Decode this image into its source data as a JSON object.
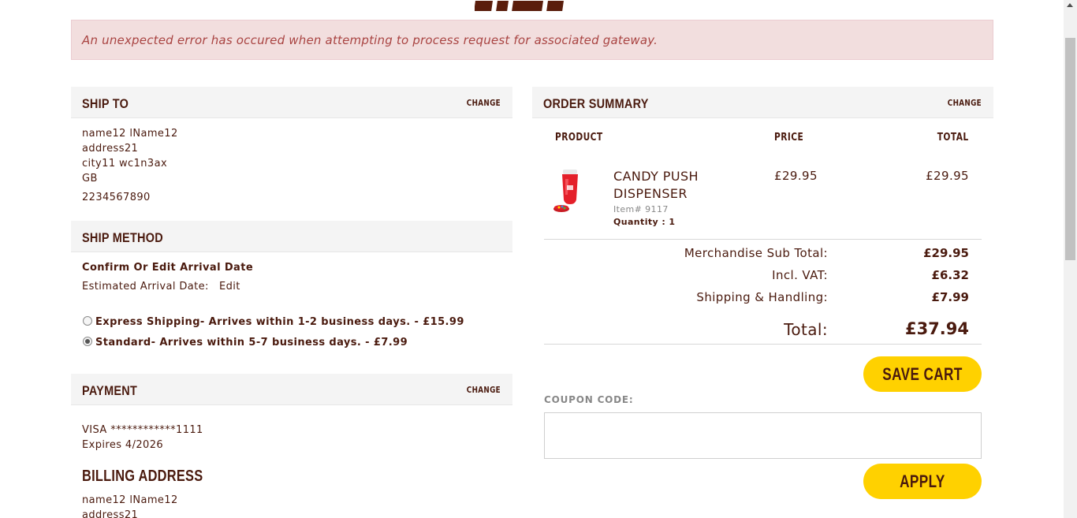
{
  "error": {
    "message": "An unexpected error has occured when attempting to process request for associated gateway."
  },
  "ship_to": {
    "title": "SHIP TO",
    "change_label": "CHANGE",
    "lines": [
      "name12 lName12",
      "address21",
      "city11 wc1n3ax",
      "GB"
    ],
    "phone": "2234567890"
  },
  "ship_method": {
    "title": "SHIP METHOD",
    "confirm_label": "Confirm Or Edit Arrival Date",
    "estimated_label": "Estimated Arrival Date:",
    "edit_label": "Edit",
    "options": [
      {
        "label": "Express Shipping- Arrives within 1-2 business days.  - £15.99",
        "selected": false
      },
      {
        "label": "Standard- Arrives within 5-7 business days.  - £7.99",
        "selected": true
      }
    ]
  },
  "payment": {
    "title": "PAYMENT",
    "change_label": "CHANGE",
    "card": "VISA ************1111",
    "expires": "Expires 4/2026"
  },
  "billing": {
    "title": "BILLING ADDRESS",
    "lines": [
      "name12 lName12",
      "address21"
    ]
  },
  "order_summary": {
    "title": "ORDER SUMMARY",
    "change_label": "CHANGE",
    "columns": {
      "product": "PRODUCT",
      "price": "PRICE",
      "total": "TOTAL"
    },
    "items": [
      {
        "name_line1": "CANDY PUSH",
        "name_line2": "DISPENSER",
        "item_no": "Item# 9117",
        "quantity": "Quantity : 1",
        "price": "£29.95",
        "total": "£29.95"
      }
    ],
    "totals": {
      "subtotal_label": "Merchandise Sub Total:",
      "subtotal": "£29.95",
      "vat_label": "Incl. VAT:",
      "vat": "£6.32",
      "shipping_label": "Shipping & Handling:",
      "shipping": "£7.99",
      "total_label": "Total:",
      "total": "£37.94"
    },
    "save_cart_label": "SAVE CART",
    "coupon_label": "COUPON CODE:",
    "coupon_value": "",
    "apply_label": "APPLY"
  },
  "colors": {
    "brand_brown": "#4a1a0e",
    "accent_yellow": "#ffd100",
    "error_bg": "#f2dede",
    "error_text": "#a94442"
  }
}
